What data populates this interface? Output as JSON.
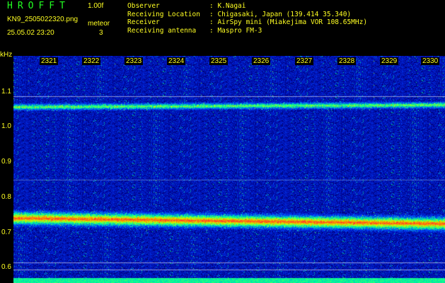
{
  "header": {
    "logo": "HROFFT",
    "version": "1.00f",
    "filename": "KN9_2505022320.png",
    "meteor_label": "meteor",
    "datetime": "25.05.02 23:20",
    "meteor_count": "3"
  },
  "info": [
    {
      "key": "Observer",
      "value": ": K.Nagai"
    },
    {
      "key": "Receiving Location",
      "value": ": Chigasaki, Japan (139.414 35.340)"
    },
    {
      "key": "Receiver",
      "value": ": AirSpy mini (Miakejima VOR 108.65MHz)"
    },
    {
      "key": "Receiving antenna",
      "value": ": Maspro FM-3"
    }
  ],
  "axis": {
    "unit": "kHz",
    "x_labels": [
      "2321",
      "2322",
      "2323",
      "2324",
      "2325",
      "2326",
      "2327",
      "2328",
      "2329",
      "2330"
    ],
    "y_labels": [
      "1.1",
      "1.0",
      "0.9",
      "0.8",
      "0.7",
      "0.6"
    ]
  },
  "colors": {
    "text": "#ffff22",
    "logo": "#22ff22",
    "background": "#000000",
    "noise": "#1a3cff",
    "signal_hot": "#ff3030"
  }
}
